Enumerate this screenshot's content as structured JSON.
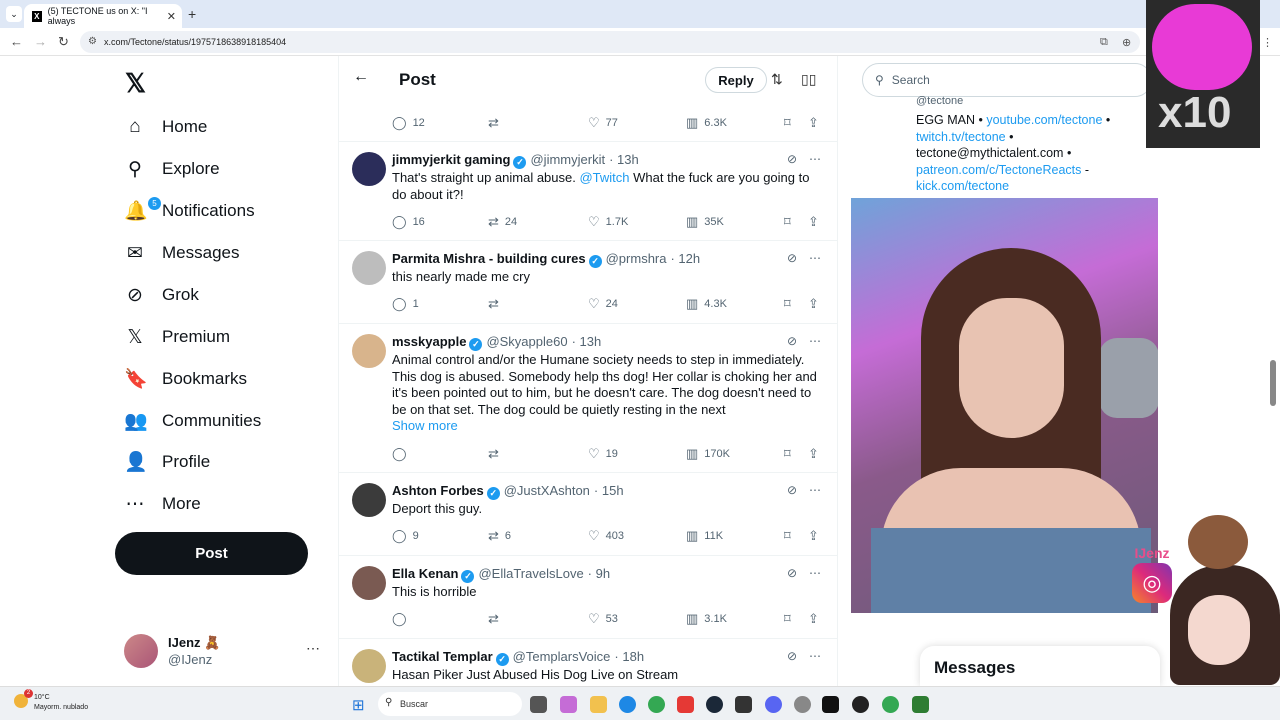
{
  "browser": {
    "tab_title": "(5) TECTONE us on X: \"I always",
    "tab_favicon": "X",
    "url": "x.com/Tectone/status/1975718638918185404",
    "close_glyph": "✕",
    "new_tab_glyph": "+"
  },
  "nav": {
    "logo": "𝕏",
    "notifications_badge": "5",
    "items": [
      {
        "label": "Home",
        "icon": "home-icon",
        "glyph": "⌂"
      },
      {
        "label": "Explore",
        "icon": "search-icon",
        "glyph": "⚲"
      },
      {
        "label": "Notifications",
        "icon": "bell-icon",
        "glyph": "🔔"
      },
      {
        "label": "Messages",
        "icon": "envelope-icon",
        "glyph": "✉"
      },
      {
        "label": "Grok",
        "icon": "grok-icon",
        "glyph": "⊘"
      },
      {
        "label": "Premium",
        "icon": "x-icon",
        "glyph": "𝕏"
      },
      {
        "label": "Bookmarks",
        "icon": "bookmark-icon",
        "glyph": "🔖"
      },
      {
        "label": "Communities",
        "icon": "people-icon",
        "glyph": "👥"
      },
      {
        "label": "Profile",
        "icon": "person-icon",
        "glyph": "👤"
      },
      {
        "label": "More",
        "icon": "more-circle-icon",
        "glyph": "⋯"
      }
    ],
    "post_button": "Post",
    "account": {
      "name": "IJenz 🧸",
      "handle": "@IJenz"
    }
  },
  "header": {
    "title": "Post",
    "reply_button": "Reply"
  },
  "first_actions": {
    "replies": "12",
    "reposts": "",
    "likes": "77",
    "views": "6.3K"
  },
  "tweets": [
    {
      "name": "jimmyjerkit gaming",
      "handle": "@jimmyjerkit",
      "time": "· 13h",
      "text_pre": "That's straight up animal abuse. ",
      "mention": "@Twitch",
      "text_post": " What the fuck are you going to do about it?!",
      "replies": "16",
      "reposts": "24",
      "likes": "1.7K",
      "views": "35K"
    },
    {
      "name": "Parmita Mishra - building cures",
      "handle": "@prmshra",
      "time": "· 12h",
      "text": "this nearly made me cry",
      "replies": "1",
      "reposts": "",
      "likes": "24",
      "views": "4.3K"
    },
    {
      "name": "msskyapple",
      "handle": "@Skyapple60",
      "time": "· 13h",
      "text": "Animal control and/or the Humane society needs to step in immediately. This dog is abused. Somebody help ths dog! Her collar is choking her and it's been pointed out to him, but he doesn't care. The dog doesn't need to be on that set. The dog could be quietly resting in the next",
      "show_more": "Show more",
      "replies": "",
      "reposts": "",
      "likes": "19",
      "views": "170K"
    },
    {
      "name": "Ashton Forbes",
      "handle": "@JustXAshton",
      "time": "· 15h",
      "text": "Deport this guy.",
      "replies": "9",
      "reposts": "6",
      "likes": "403",
      "views": "11K"
    },
    {
      "name": "Ella Kenan",
      "handle": "@EllaTravelsLove",
      "time": "· 9h",
      "text": "This is horrible",
      "replies": "",
      "reposts": "",
      "likes": "53",
      "views": "3.1K"
    },
    {
      "name": "Tactikal Templar",
      "handle": "@TemplarsVoice",
      "time": "· 18h",
      "text": "Hasan Piker Just Abused His Dog Live on Stream"
    }
  ],
  "right": {
    "search_placeholder": "Search",
    "bio_top": "@tectone",
    "bio_plain1": "EGG MAN • ",
    "bio_link1": "youtube.com/tectone",
    "bio_sep": " •",
    "bio_link2": "twitch.tv/tectone",
    "bio_plain2": "tectone@mythictalent.com •",
    "bio_link3": "patreon.com/c/TectoneReacts",
    "bio_sep2": " -",
    "bio_link4": "kick.com/tectone",
    "messages": "Messages",
    "overlay_name": "IJenz",
    "overlay_multiplier": "x10"
  },
  "taskbar": {
    "temp": "10°C",
    "weather": "Mayorm. nublado",
    "search": "Buscar",
    "alert_badge": "2"
  },
  "colors": {
    "accent": "#1d9bf0",
    "brand_dark": "#0f1419"
  }
}
